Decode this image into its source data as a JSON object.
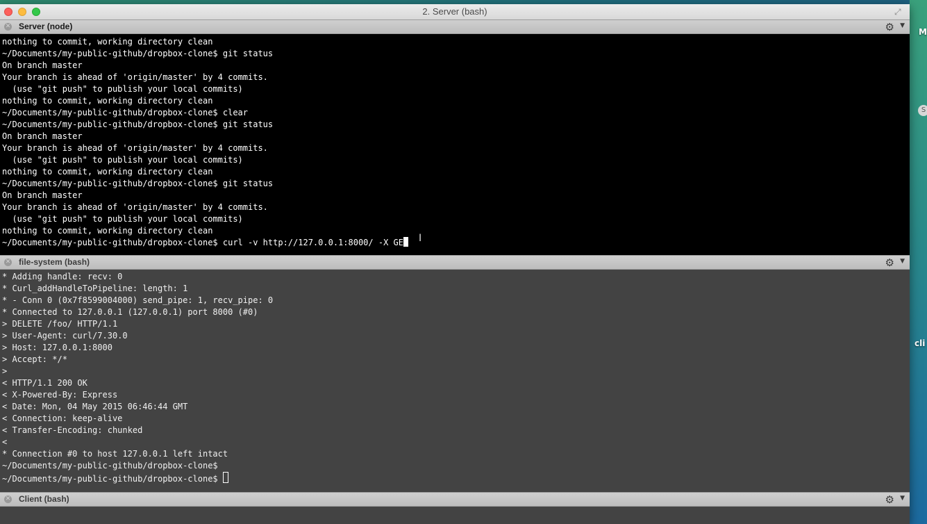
{
  "window": {
    "title": "2. Server (bash)"
  },
  "desktop": {
    "edge_text_1": "M",
    "edge_text_2": "cli",
    "edge_icon": "S"
  },
  "panes": [
    {
      "title": "Server (node)",
      "active": true,
      "lines": [
        "nothing to commit, working directory clean",
        "~/Documents/my-public-github/dropbox-clone$ git status",
        "On branch master",
        "Your branch is ahead of 'origin/master' by 4 commits.",
        "  (use \"git push\" to publish your local commits)",
        "nothing to commit, working directory clean",
        "~/Documents/my-public-github/dropbox-clone$ clear",
        "~/Documents/my-public-github/dropbox-clone$ git status",
        "On branch master",
        "Your branch is ahead of 'origin/master' by 4 commits.",
        "  (use \"git push\" to publish your local commits)",
        "nothing to commit, working directory clean",
        "~/Documents/my-public-github/dropbox-clone$ git status",
        "On branch master",
        "Your branch is ahead of 'origin/master' by 4 commits.",
        "  (use \"git push\" to publish your local commits)",
        "nothing to commit, working directory clean"
      ],
      "prompt_line": "~/Documents/my-public-github/dropbox-clone$ curl -v http://127.0.0.1:8000/ -X GE"
    },
    {
      "title": "file-system (bash)",
      "active": false,
      "lines": [
        "* Adding handle: recv: 0",
        "* Curl_addHandleToPipeline: length: 1",
        "* - Conn 0 (0x7f8599004000) send_pipe: 1, recv_pipe: 0",
        "* Connected to 127.0.0.1 (127.0.0.1) port 8000 (#0)",
        "> DELETE /foo/ HTTP/1.1",
        "> User-Agent: curl/7.30.0",
        "> Host: 127.0.0.1:8000",
        "> Accept: */*",
        ">",
        "< HTTP/1.1 200 OK",
        "< X-Powered-By: Express",
        "< Date: Mon, 04 May 2015 06:46:44 GMT",
        "< Connection: keep-alive",
        "< Transfer-Encoding: chunked",
        "<",
        "* Connection #0 to host 127.0.0.1 left intact",
        "~/Documents/my-public-github/dropbox-clone$"
      ],
      "prompt_line": "~/Documents/my-public-github/dropbox-clone$ "
    },
    {
      "title": "Client (bash)",
      "active": false,
      "lines": [],
      "prompt_line": ""
    }
  ],
  "icons": {
    "pane_close": "close-x-icon",
    "pane_gear": "gear-icon",
    "pane_menu": "chevron-down-icon",
    "fullscreen": "fullscreen-icon"
  }
}
